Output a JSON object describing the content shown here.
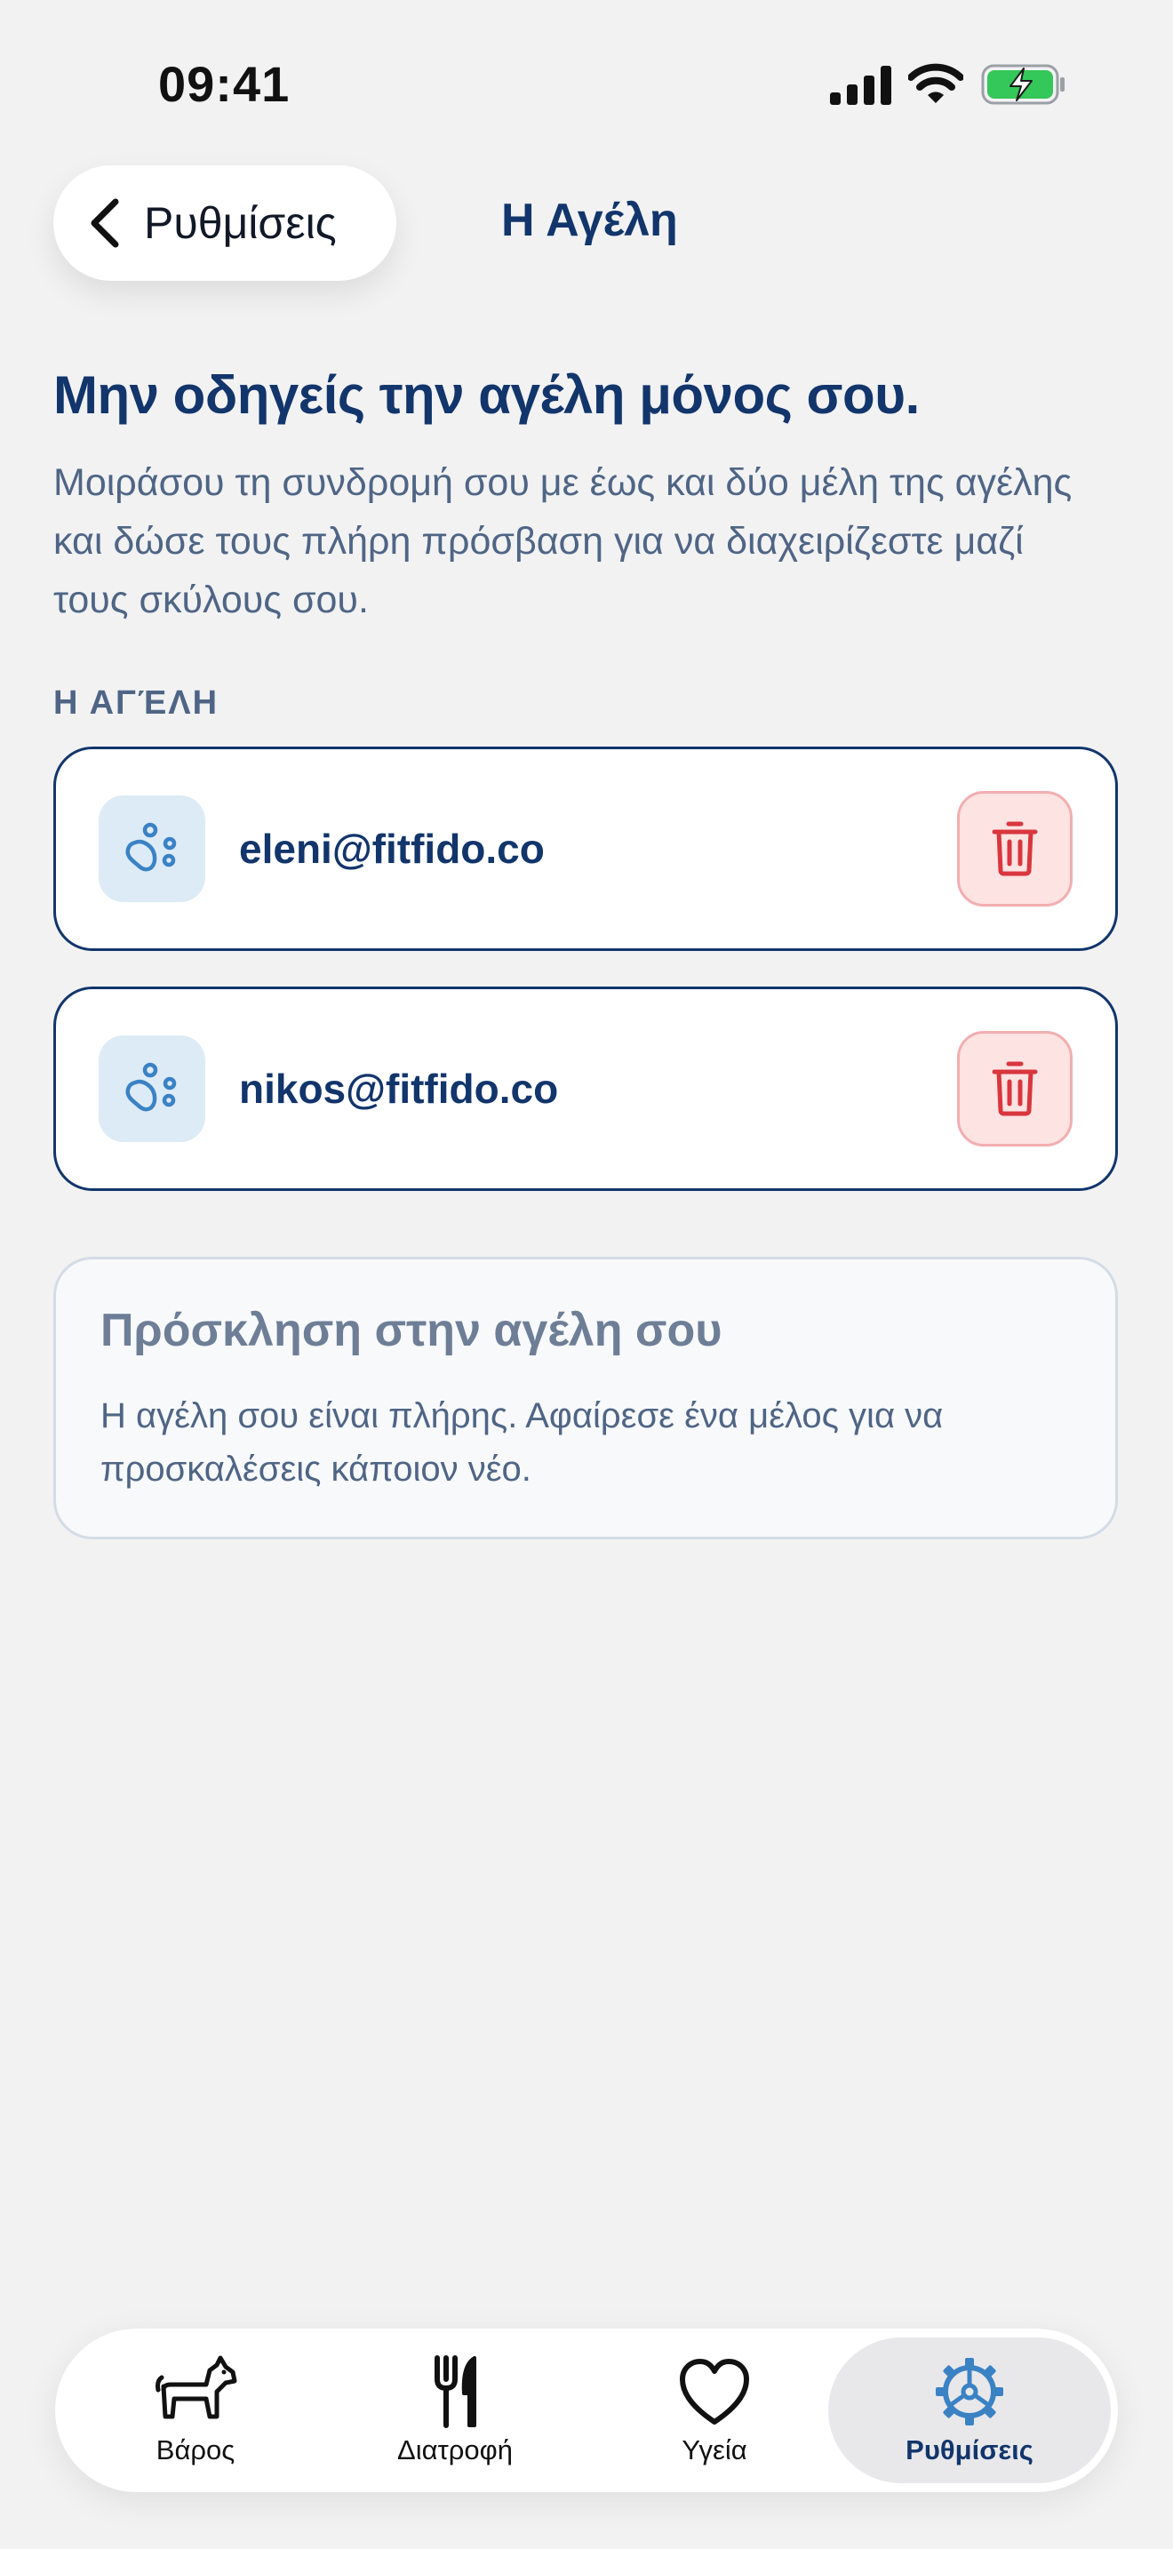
{
  "status_bar": {
    "time": "09:41"
  },
  "nav": {
    "back_label": "Ρυθμίσεις",
    "title": "Η Αγέλη"
  },
  "intro": {
    "headline": "Μην οδηγείς την αγέλη μόνος σου.",
    "description": "Μοιράσου τη συνδρομή σου με έως και δύο μέλη της αγέλης και δώσε τους πλήρη πρόσβαση για να διαχειρίζεστε μαζί τους σκύλους σου."
  },
  "pack": {
    "section_label": "Η ΑΓΈΛΗ",
    "members": [
      {
        "email": "eleni@fitfido.co",
        "icon": "paw-icon",
        "action_icon": "trash-icon"
      },
      {
        "email": "nikos@fitfido.co",
        "icon": "paw-icon",
        "action_icon": "trash-icon"
      }
    ]
  },
  "invite": {
    "title": "Πρόσκληση στην αγέλη σου",
    "message": "Η αγέλη σου είναι πλήρης. Αφαίρεσε ένα μέλος για να προσκαλέσεις κάποιον νέο."
  },
  "tab_bar": {
    "tabs": [
      {
        "label": "Βάρος",
        "icon": "dog-icon"
      },
      {
        "label": "Διατροφή",
        "icon": "fork-knife-icon"
      },
      {
        "label": "Υγεία",
        "icon": "heart-icon"
      },
      {
        "label": "Ρυθμίσεις",
        "icon": "gear-icon",
        "active": true
      }
    ]
  },
  "colors": {
    "primary": "#12356b",
    "muted_text": "#4f6585",
    "danger": "#d9363e",
    "danger_bg": "#fde3e2",
    "accent": "#3b82c4",
    "background": "#f2f2f3"
  }
}
